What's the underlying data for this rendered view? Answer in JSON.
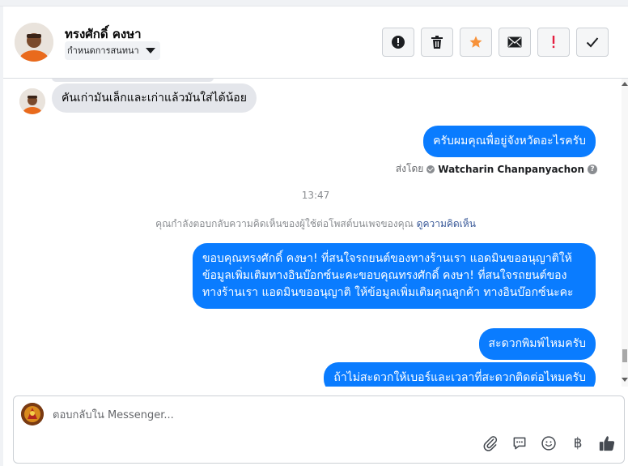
{
  "header": {
    "contact_name": "ทรงศักดิ์ คงษา",
    "assign_label": "กำหนดการสนทนา",
    "actions": [
      {
        "icon": "alert-circle-icon",
        "name": "mark-spam-button"
      },
      {
        "icon": "trash-icon",
        "name": "delete-button"
      },
      {
        "icon": "star-icon",
        "name": "star-button"
      },
      {
        "icon": "envelope-icon",
        "name": "mark-unread-button"
      },
      {
        "icon": "exclamation-icon",
        "name": "follow-up-button"
      },
      {
        "icon": "checkmark-icon",
        "name": "mark-done-button"
      }
    ]
  },
  "thread": {
    "incoming": {
      "text": "คันเก่ามันเล็กและเก่าแล้วมันใส่ได้น้อย"
    },
    "outgoing_1": {
      "text": "ครับผมคุณพื่อยู่จังหวัดอะไรครับ"
    },
    "sent_by": {
      "prefix": "ส่งโดย",
      "name": "Watcharin Chanpanyachon"
    },
    "time": "13:47",
    "notice": {
      "text": "คุณกำลังตอบกลับความคิดเห็นของผู้ใช้ต่อโพสต์บนเพจของคุณ",
      "link": "ดูความคิดเห็น"
    },
    "outgoing_2": {
      "text": "ขอบคุณทรงศักดิ์ คงษา! ที่สนใจรถยนต์ของทางร้านเรา แอดมินขออนุญาติให้ข้อมูลเพิ่มเติมทางอินบ๊อกซ์นะคะขอบคุณทรงศักดิ์ คงษา! ที่สนใจรถยนต์ของทางร้านเรา แอดมินขออนุญาติ ให้ข้อมูลเพิ่มเติมคุณลูกค้า ทางอินบ๊อกซ์นะคะ"
    },
    "outgoing_3": {
      "text": "สะดวกพิมพ์ไหมครับ"
    },
    "outgoing_4": {
      "text": "ถ้าไม่สะดวกให้เบอร์และเวลาที่สะดวกติดต่อไหมครับ"
    }
  },
  "composer": {
    "placeholder": "ตอบกลับใน Messenger...",
    "value": "",
    "tools": [
      "paperclip-icon",
      "saved-reply-icon",
      "emoji-icon",
      "baht-payment-icon",
      "thumbs-up-icon"
    ]
  },
  "colors": {
    "accent": "#0a7cff",
    "incoming_bubble": "#e4e6eb",
    "star": "#f7923a",
    "follow_up": "#e41e3f"
  }
}
